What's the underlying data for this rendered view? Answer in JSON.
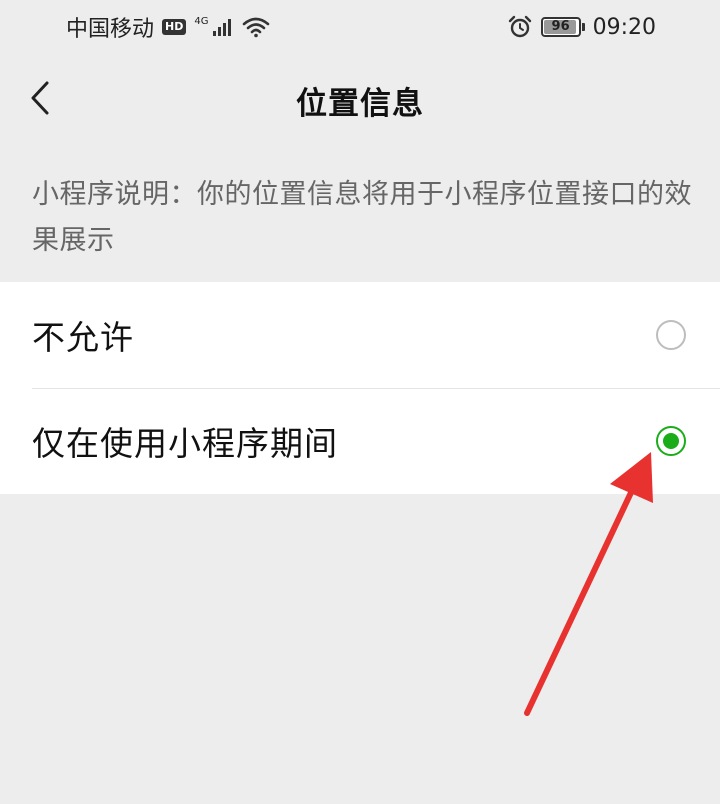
{
  "status_bar": {
    "carrier": "中国移动",
    "hd_badge": "HD",
    "network_gen": "4G",
    "battery_level": "96",
    "time": "09:20",
    "icons": [
      "signal-icon",
      "wifi-icon",
      "alarm-icon",
      "battery-icon"
    ]
  },
  "nav": {
    "title": "位置信息",
    "back_icon": "chevron-left-icon"
  },
  "description": {
    "text": "小程序说明：你的位置信息将用于小程序位置接口的效果展示"
  },
  "options": [
    {
      "label": "不允许",
      "selected": false
    },
    {
      "label": "仅在使用小程序期间",
      "selected": true
    }
  ],
  "colors": {
    "background": "#ededed",
    "accent_green": "#1aad19",
    "annotation_red": "#e8322f"
  }
}
